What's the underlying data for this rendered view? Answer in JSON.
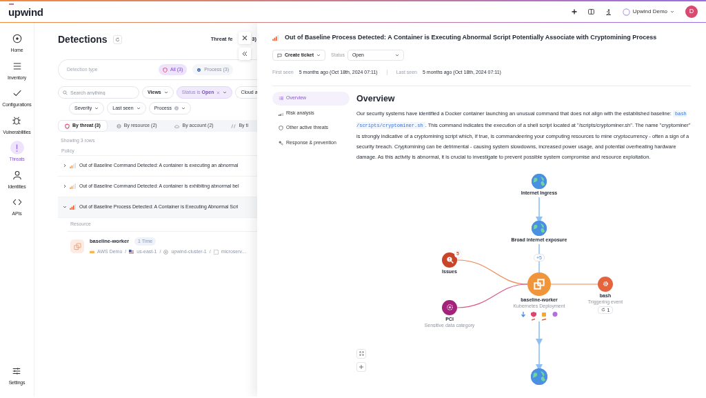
{
  "topbar": {
    "logo": "upwind",
    "account": "Upwind Demo",
    "avatar": "D"
  },
  "sidebar": {
    "items": [
      {
        "kind": "home",
        "label": "Home",
        "selected": false
      },
      {
        "kind": "inventory",
        "label": "Inventory",
        "selected": false
      },
      {
        "kind": "configurations",
        "label": "Configurations",
        "selected": false
      },
      {
        "kind": "vulnerabilities",
        "label": "Vulnerabilities",
        "selected": false
      },
      {
        "kind": "threats",
        "label": "Threats",
        "selected": true
      },
      {
        "kind": "identities",
        "label": "Identities",
        "selected": false
      },
      {
        "kind": "apis",
        "label": "APIs",
        "selected": false
      }
    ],
    "footer": {
      "kind": "settings",
      "label": "Settings",
      "selected": false
    }
  },
  "detections": {
    "title": "Detections",
    "threat_feed": "Threat fe",
    "threat_feed_end": "3)",
    "detection_type": {
      "placeholder": "Detection type",
      "chips": [
        {
          "kind": "all",
          "label": "All (3)",
          "selected": true
        },
        {
          "kind": "process",
          "label": "Process (3)",
          "selected": false
        }
      ]
    },
    "search": {
      "placeholder": "Search anything"
    },
    "filters": [
      [
        {
          "kind": "menu",
          "label": "Views"
        },
        {
          "kind": "status",
          "label": "Status is **Open**"
        },
        {
          "kind": "plain",
          "label": "Cloud a"
        }
      ],
      [
        {
          "kind": "menu",
          "label": "Severity"
        },
        {
          "kind": "menu",
          "label": "Last seen"
        },
        {
          "kind": "info",
          "label": "Process"
        }
      ]
    ],
    "group_tabs": [
      {
        "kind": "threat",
        "label": "By threat (3)",
        "selected": true
      },
      {
        "kind": "resource",
        "label": "By resource (2)",
        "selected": false
      },
      {
        "kind": "account",
        "label": "By account (2)",
        "selected": false
      },
      {
        "kind": "time",
        "label": "By ti",
        "selected": false
      }
    ],
    "row_count": "Showing 3 rows",
    "column": "Policy",
    "policies": [
      {
        "title": "Out of Baseline Command Detected: A container is executing an abnormal",
        "level": 0.5,
        "expanded": false
      },
      {
        "title": "Out of Baseline Command Detected: A container is exhibiting abnormal bel",
        "level": 0.5,
        "expanded": false
      },
      {
        "title": "Out of Baseline Process Detected: A Container is Executing Abnormal Scri",
        "level": 0.75,
        "expanded": true
      }
    ],
    "resources": {
      "column": "Resource",
      "rows": [
        {
          "name": "baseline-worker",
          "count": "1 Time",
          "separator": "/",
          "path": [
            {
              "kind": "aws",
              "label": "AWS Demo"
            },
            {
              "kind": "region",
              "label": "us-east-1"
            },
            {
              "kind": "cluster",
              "label": "upwind-cluster-1"
            },
            {
              "kind": "namespace",
              "label": "microserv..."
            }
          ]
        }
      ]
    }
  },
  "detail": {
    "title": "Out of Baseline Process Detected: A Container is Executing Abnormal Script Potentially Associate with Cryptomining Process",
    "level": 0.75,
    "create_ticket": "Create ticket",
    "status_label": "Status",
    "status_value": "Open",
    "first_seen_label": "First seen",
    "first_seen": "5 months ago (Oct 18th, 2024 07:11)",
    "last_seen_label": "Last seen",
    "last_seen": "5 months ago (Oct 18th, 2024 07:11)",
    "nav": [
      {
        "kind": "list",
        "label": "Overview",
        "selected": true
      },
      {
        "kind": "risk",
        "label": "Risk analysis",
        "selected": false
      },
      {
        "kind": "shield",
        "label": "Other active threats",
        "selected": false
      },
      {
        "kind": "response",
        "label": "Response & prevention",
        "selected": false
      }
    ],
    "heading": "Overview",
    "text_before": "Our security systems have identified a Docker container launching an unusual command that does not align with the established baseline:",
    "command": "bash /scripts/cryptominer.sh",
    "text_after": ". This command indicates the execution of a shell script located at \"/scripts/cryptominer.sh\". The name \"cryptominer\" is strongly indicative of a cryptomining script which, if true, is commandeering your computing resources to mine cryptocurrency - often a sign of a security breach. Cryptomining can be detrimental - causing system slowdowns, increased power usage, and potential overheating hardware damage. As this activity is abnormal, it is crucial to investigate to prevent possible system compromise and resource exploitation.",
    "graph": {
      "edge_label": "+5",
      "nodes": [
        {
          "kind": "globe",
          "label": "Internet Ingress"
        },
        {
          "kind": "globe",
          "label": "Broad internet exposure"
        },
        {
          "kind": "deployment",
          "label": "baseline-worker",
          "sublabel": "Kubernetes Deployment"
        },
        {
          "kind": "issues",
          "label": "Issues",
          "badge": "5"
        },
        {
          "kind": "pci",
          "label": "PCI",
          "sublabel": "Sensitive data category"
        },
        {
          "kind": "process",
          "label": "bash",
          "sublabel": "Triggering event",
          "counter": "1"
        },
        {
          "kind": "globe"
        }
      ]
    }
  }
}
